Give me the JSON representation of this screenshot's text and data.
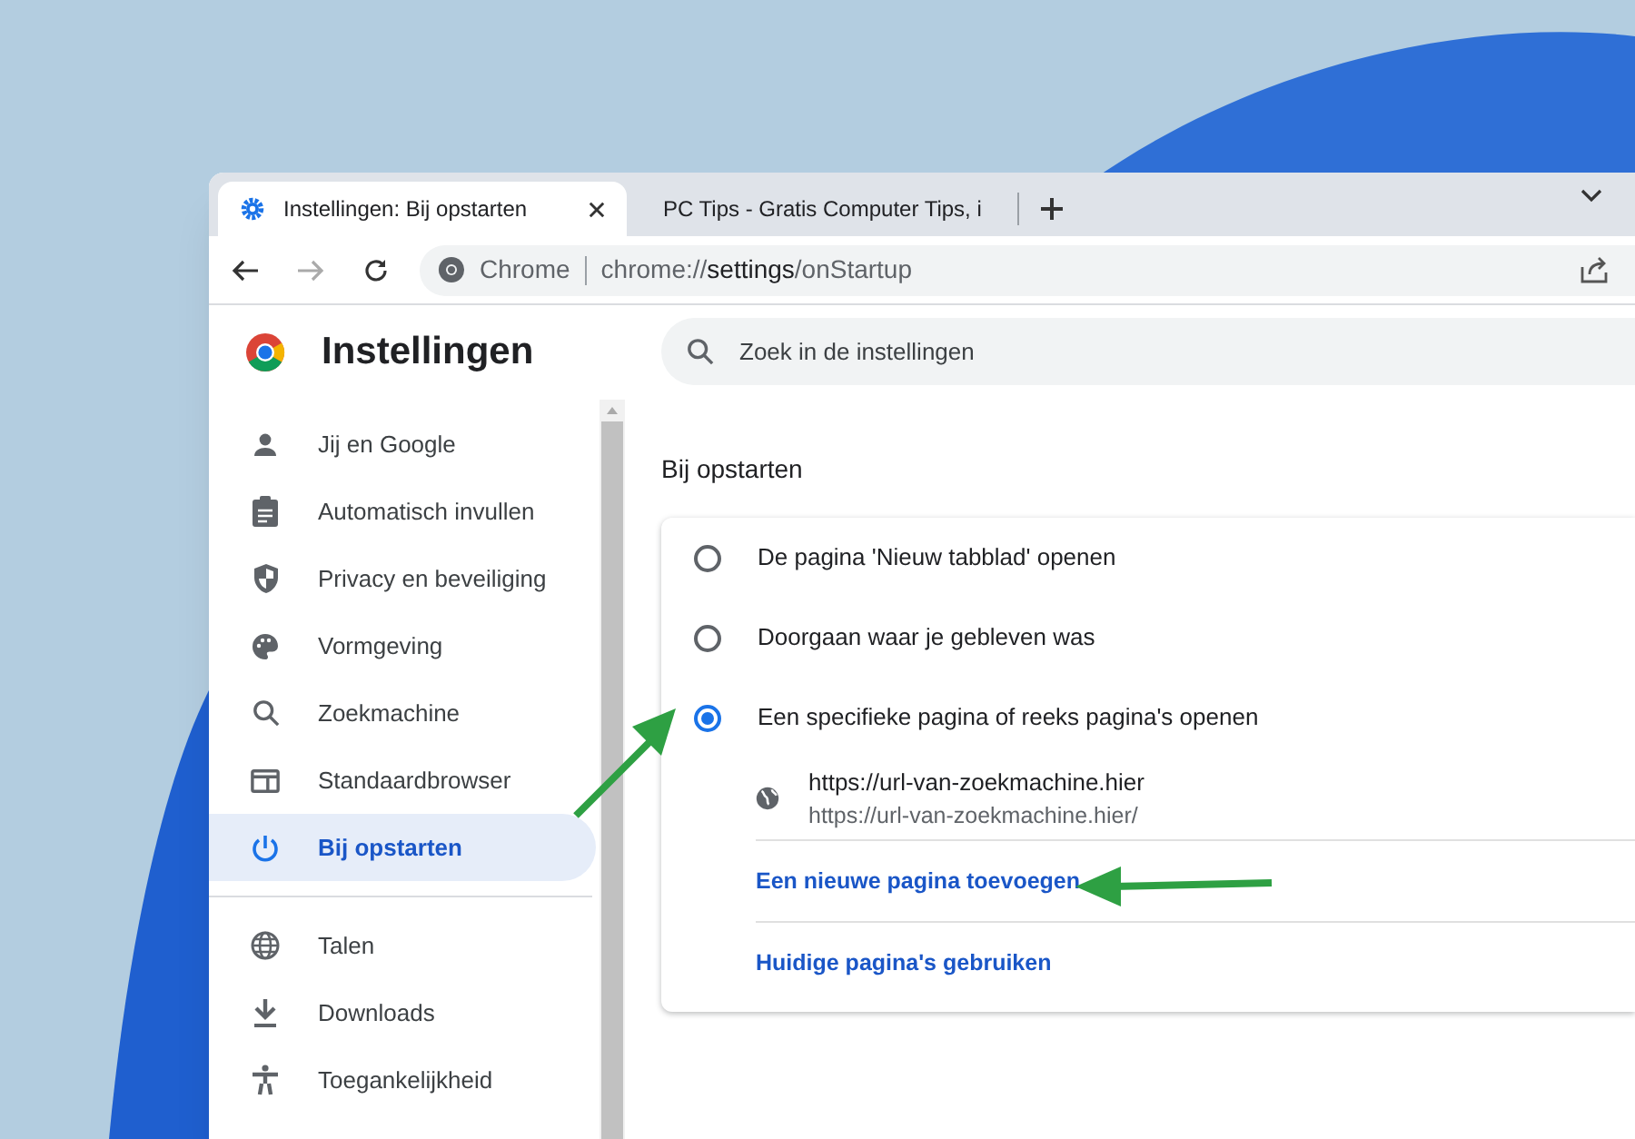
{
  "tabs": [
    {
      "title": "Instellingen: Bij opstarten",
      "selected": true
    },
    {
      "title": "PC Tips - Gratis Computer Tips, i",
      "selected": false
    }
  ],
  "toolbar": {
    "site_label": "Chrome",
    "url": "chrome://**settings**/onStartup"
  },
  "sidebar": {
    "title": "Instellingen",
    "groups": [
      [
        {
          "label": "Jij en Google",
          "selected": false
        },
        {
          "label": "Automatisch invullen",
          "selected": false
        },
        {
          "label": "Privacy en beveiliging",
          "selected": false
        },
        {
          "label": "Vormgeving",
          "selected": false
        },
        {
          "label": "Zoekmachine",
          "selected": false
        },
        {
          "label": "Standaardbrowser",
          "selected": false
        },
        {
          "label": "Bij opstarten",
          "selected": true
        }
      ],
      [
        {
          "label": "Talen",
          "selected": false
        },
        {
          "label": "Downloads",
          "selected": false
        },
        {
          "label": "Toegankelijkheid",
          "selected": false
        }
      ]
    ]
  },
  "search": {
    "placeholder": "Zoek in de instellingen"
  },
  "section": {
    "title": "Bij opstarten",
    "options": [
      {
        "label": "De pagina 'Nieuw tabblad' openen",
        "selected": false
      },
      {
        "label": "Doorgaan waar je gebleven was",
        "selected": false
      },
      {
        "label": "Een specifieke pagina of reeks pagina's openen",
        "selected": true
      }
    ],
    "pages": [
      {
        "title": "https://url-van-zoekmachine.hier",
        "url": "https://url-van-zoekmachine.hier/"
      }
    ],
    "links": [
      "Een nieuwe pagina toevoegen",
      "Huidige pagina's gebruiken"
    ]
  }
}
